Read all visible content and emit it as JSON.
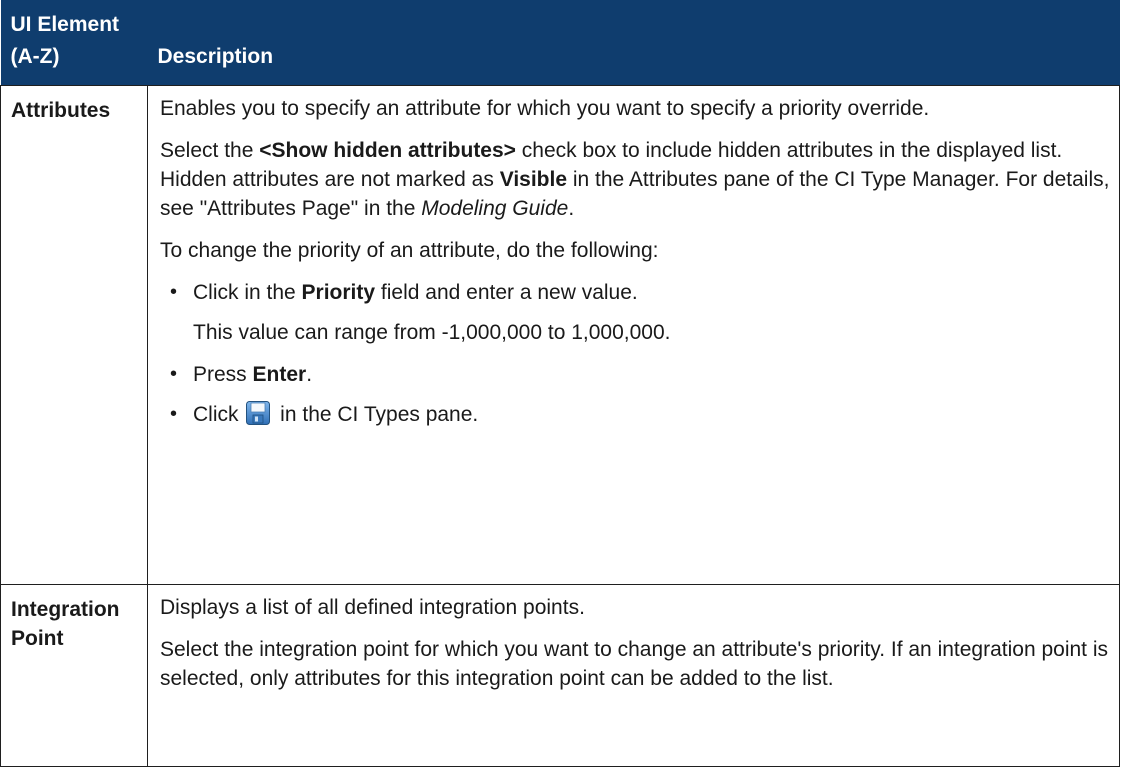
{
  "header": {
    "col1_line1": "UI Element",
    "col1_line2": "(A-Z)",
    "col2": "Description"
  },
  "rows": [
    {
      "name": "Attributes",
      "p1": "Enables you to specify an attribute for which you want to specify a priority override.",
      "p2_a": "Select the ",
      "p2_b": "<Show hidden attributes>",
      "p2_c": " check box to include hidden attributes in the displayed list. Hidden attributes are not marked as ",
      "p2_d": "Visible",
      "p2_e": " in the Attributes pane of the CI Type Manager. For details, see \"Attributes Page\" in the ",
      "p2_f": "Modeling Guide",
      "p2_g": ".",
      "p3": "To change the priority of an attribute, do the following:",
      "b1_a": "Click in the ",
      "b1_b": "Priority",
      "b1_c": " field and enter a new value.",
      "b1_sub": "This value can range from -1,000,000 to 1,000,000.",
      "b2_a": "Press ",
      "b2_b": "Enter",
      "b2_c": ".",
      "b3_a": "Click ",
      "b3_c": " in the CI Types pane.",
      "bullet": "•",
      "save_icon": "save-icon"
    },
    {
      "name_line1": "Integration",
      "name_line2": "Point",
      "p1": "Displays a list of all defined integration points.",
      "p2": "Select the integration point for which you want to change an attribute's priority. If an integration point is selected, only attributes for this integration point can be added to the list."
    }
  ],
  "colors": {
    "header_bg": "#0f3d6e",
    "header_text": "#ffffff",
    "border": "#1f1f1f"
  }
}
